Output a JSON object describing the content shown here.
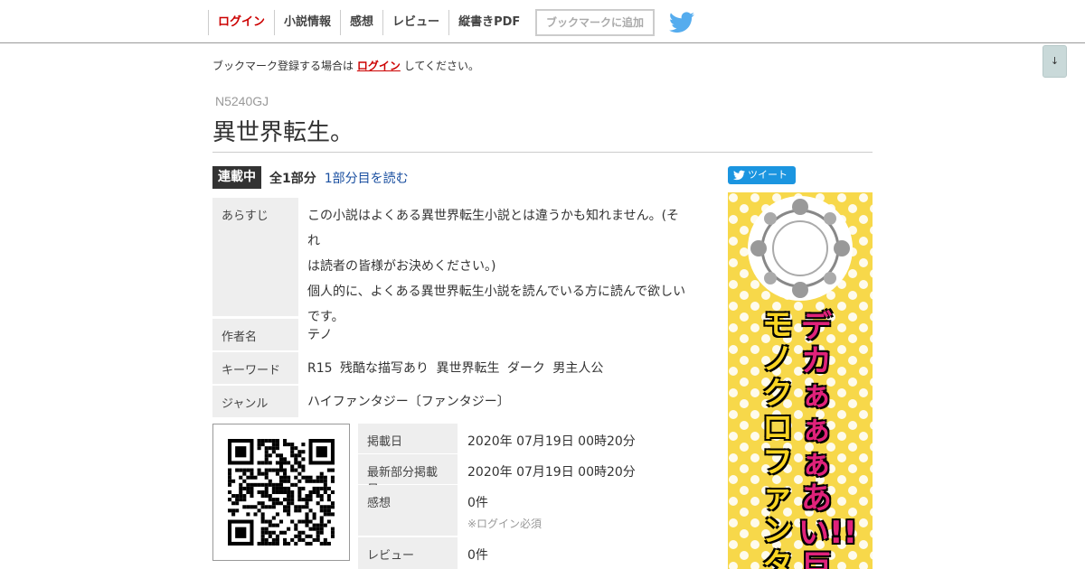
{
  "nav": {
    "items": [
      "ログイン",
      "小説情報",
      "感想",
      "レビュー",
      "縦書きPDF"
    ],
    "bookmark_button": "ブックマークに追加"
  },
  "scroll_button": "↓",
  "login_notice": {
    "before": "ブックマーク登録する場合は",
    "link": "ログイン",
    "after": "してください。"
  },
  "novel": {
    "ncode": "N5240GJ",
    "title": "異世界転生。",
    "status": "連載中",
    "parts": "全1部分",
    "read_link": "1部分目を読む"
  },
  "info": {
    "synopsis_label": "あらすじ",
    "synopsis_lines": [
      "この小説はよくある異世界転生小説とは違うかも知れません。(それ",
      "は読者の皆様がお決めください。)",
      "個人的に、よくある異世界転生小説を読んでいる方に読んで欲しい",
      "です。"
    ],
    "author_label": "作者名",
    "author": "テノ",
    "keyword_label": "キーワード",
    "keywords": [
      "R15",
      "残酷な描写あり",
      "異世界転生",
      " ダーク",
      "男主人公"
    ],
    "genre_label": "ジャンル",
    "genre": "ハイファンタジー〔ファンタジー〕"
  },
  "dates": {
    "posted_label": "掲載日",
    "posted": "2020年 07月19日 00時20分",
    "latest_label": "最新部分掲載日",
    "latest": "2020年 07月19日 00時20分",
    "impressions_label": "感想",
    "impressions": "0件",
    "impressions_note": "※ログイン必須",
    "reviews_label": "レビュー",
    "reviews": "0件"
  },
  "tweet_button": "ツイート",
  "ad": {
    "line1": "デカぁぁぁあい!!巨",
    "line2": "モノクロファンタ"
  },
  "colors": {
    "accent_red": "#cc0000",
    "link_blue": "#1a4fa0",
    "twitter_blue": "#1b95e0",
    "badge_dark": "#333333",
    "ad_yellow": "#f7d84a"
  }
}
